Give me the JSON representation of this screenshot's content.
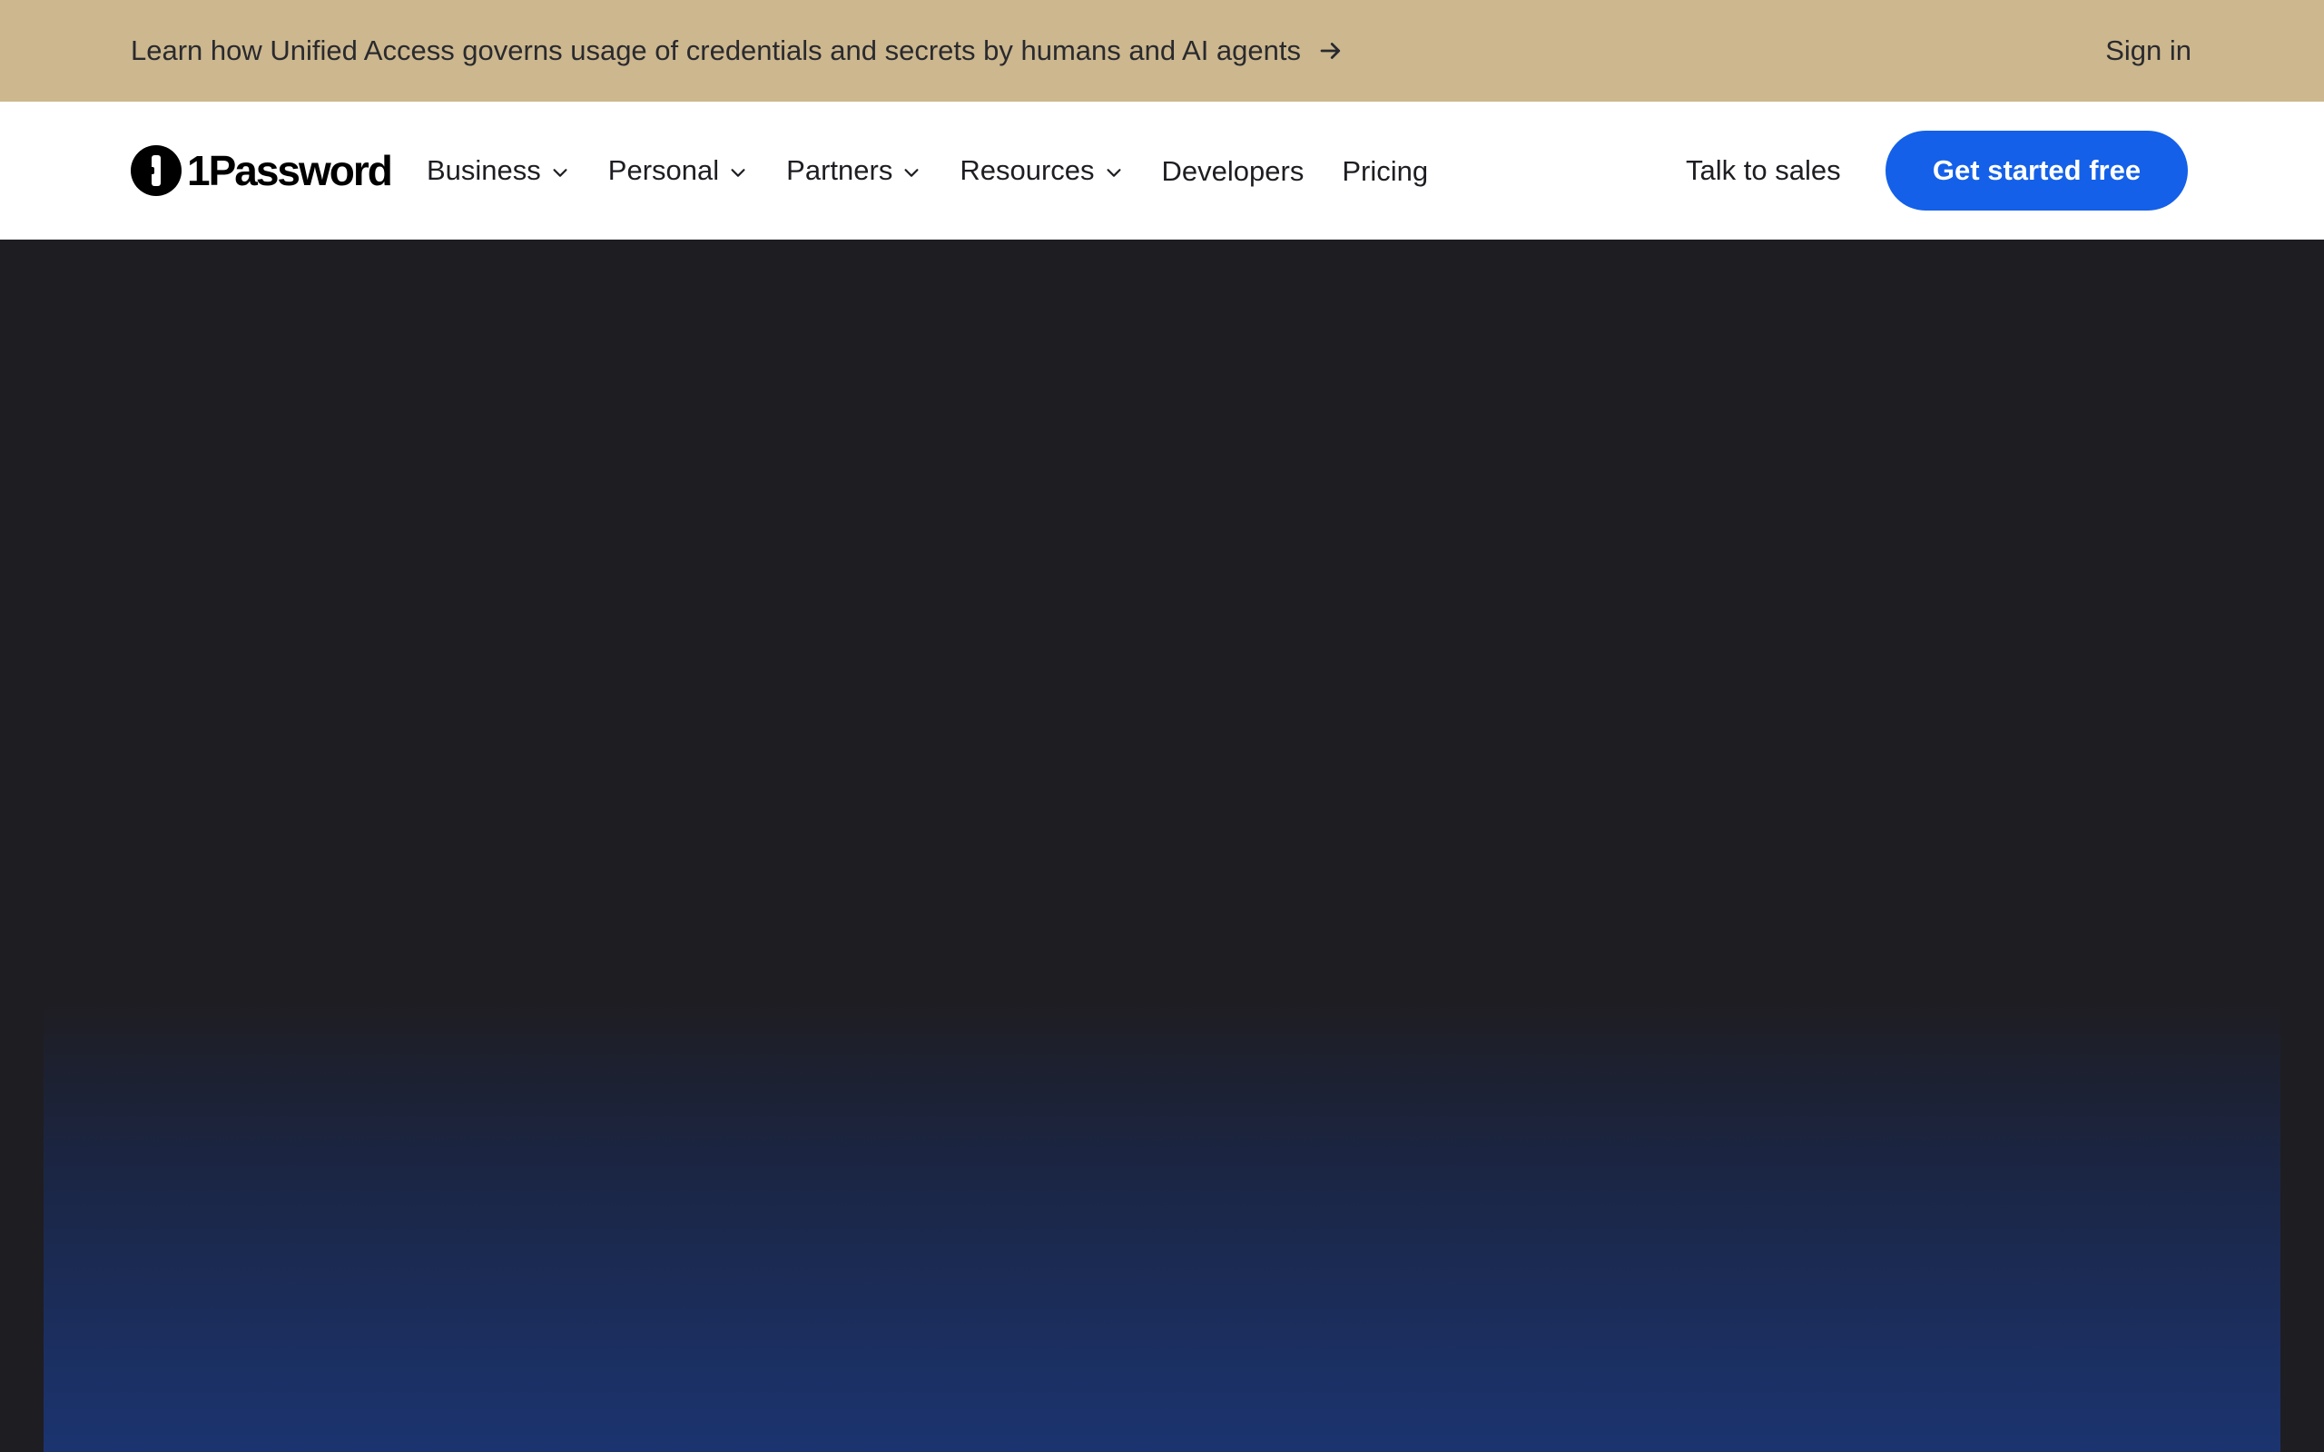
{
  "announcement": {
    "text": "Learn how Unified Access governs usage of credentials and secrets by humans and AI agents",
    "arrow_icon": "arrow-right-icon",
    "background": "#ccb78e"
  },
  "header": {
    "sign_in": "Sign in"
  },
  "brand": {
    "name": "1Password",
    "logo_icon": "1password-keyhole-icon"
  },
  "nav": {
    "items": [
      {
        "label": "Business",
        "has_dropdown": true
      },
      {
        "label": "Personal",
        "has_dropdown": true
      },
      {
        "label": "Partners",
        "has_dropdown": true
      },
      {
        "label": "Resources",
        "has_dropdown": true
      },
      {
        "label": "Developers",
        "has_dropdown": false
      },
      {
        "label": "Pricing",
        "has_dropdown": false
      }
    ],
    "talk_to_sales": "Talk to sales",
    "cta": "Get started free",
    "cta_color": "#1460e8"
  },
  "hero": {
    "background": "#1e1d22",
    "gradient_bottom": "#1b3470"
  }
}
